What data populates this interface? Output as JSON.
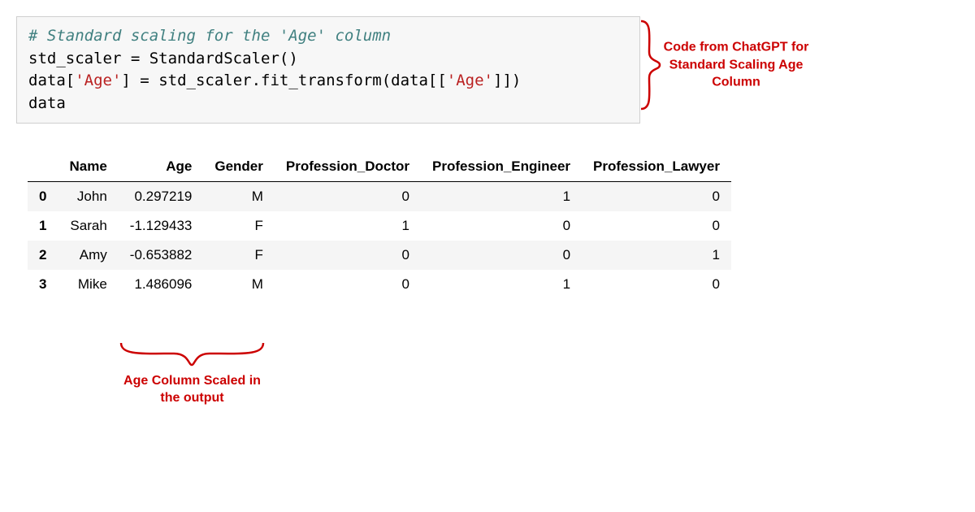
{
  "code": {
    "comment": "# Standard scaling for the 'Age' column",
    "line2a": "std_scaler ",
    "line2b": "=",
    "line2c": " StandardScaler()",
    "line3a": "data[",
    "line3b": "'Age'",
    "line3c": "] ",
    "line3d": "=",
    "line3e": " std_scaler.fit_transform(data[[",
    "line3f": "'Age'",
    "line3g": "]])",
    "line4": "data"
  },
  "annotations": {
    "right": "Code from ChatGPT for Standard Scaling Age Column",
    "bottom": "Age Column Scaled in the output"
  },
  "table": {
    "columns": [
      "",
      "Name",
      "Age",
      "Gender",
      "Profession_Doctor",
      "Profession_Engineer",
      "Profession_Lawyer"
    ],
    "rows": [
      {
        "idx": "0",
        "name": "John",
        "age": "0.297219",
        "gender": "M",
        "pd": "0",
        "pe": "1",
        "pl": "0"
      },
      {
        "idx": "1",
        "name": "Sarah",
        "age": "-1.129433",
        "gender": "F",
        "pd": "1",
        "pe": "0",
        "pl": "0"
      },
      {
        "idx": "2",
        "name": "Amy",
        "age": "-0.653882",
        "gender": "F",
        "pd": "0",
        "pe": "0",
        "pl": "1"
      },
      {
        "idx": "3",
        "name": "Mike",
        "age": "1.486096",
        "gender": "M",
        "pd": "0",
        "pe": "1",
        "pl": "0"
      }
    ]
  }
}
